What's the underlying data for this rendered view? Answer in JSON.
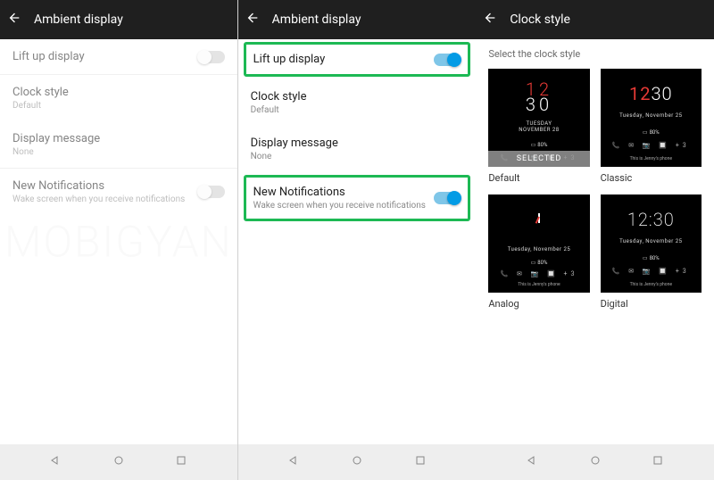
{
  "panes": {
    "left": {
      "title": "Ambient display",
      "rows": {
        "liftup": {
          "label": "Lift up display"
        },
        "clockstyle": {
          "label": "Clock style",
          "sub": "Default"
        },
        "displaymsg": {
          "label": "Display message",
          "sub": "None"
        },
        "newnotif": {
          "label": "New Notifications",
          "sub": "Wake screen when you receive notifications"
        }
      }
    },
    "middle": {
      "title": "Ambient display",
      "rows": {
        "liftup": {
          "label": "Lift up display"
        },
        "clockstyle": {
          "label": "Clock style",
          "sub": "Default"
        },
        "displaymsg": {
          "label": "Display message",
          "sub": "None"
        },
        "newnotif": {
          "label": "New Notifications",
          "sub": "Wake screen when you receive notifications"
        }
      }
    },
    "right": {
      "title": "Clock style",
      "subheader": "Select the clock style",
      "styles": {
        "default": {
          "caption": "Default",
          "time_h": "12",
          "time_m": "30",
          "date": "TUESDAY\nNOVEMBER 28",
          "battery": "80%",
          "owner": "",
          "selected": "SELECTED"
        },
        "classic": {
          "caption": "Classic",
          "time_h": "12",
          "time_m": "30",
          "date": "Tuesday, November 25",
          "battery": "80%",
          "owner": "This is Jenny's phone"
        },
        "analog": {
          "caption": "Analog",
          "date": "Tuesday, November 25",
          "battery": "80%",
          "owner": "This is Jenny's phone"
        },
        "digital": {
          "caption": "Digital",
          "time": "12:30",
          "date": "Tuesday, November 25",
          "battery": "80%",
          "owner": "This is Jenny's phone"
        }
      }
    }
  },
  "iconsrow": "📞  ✉  📷  🔲  +3",
  "watermark": "MOBIGYAN"
}
